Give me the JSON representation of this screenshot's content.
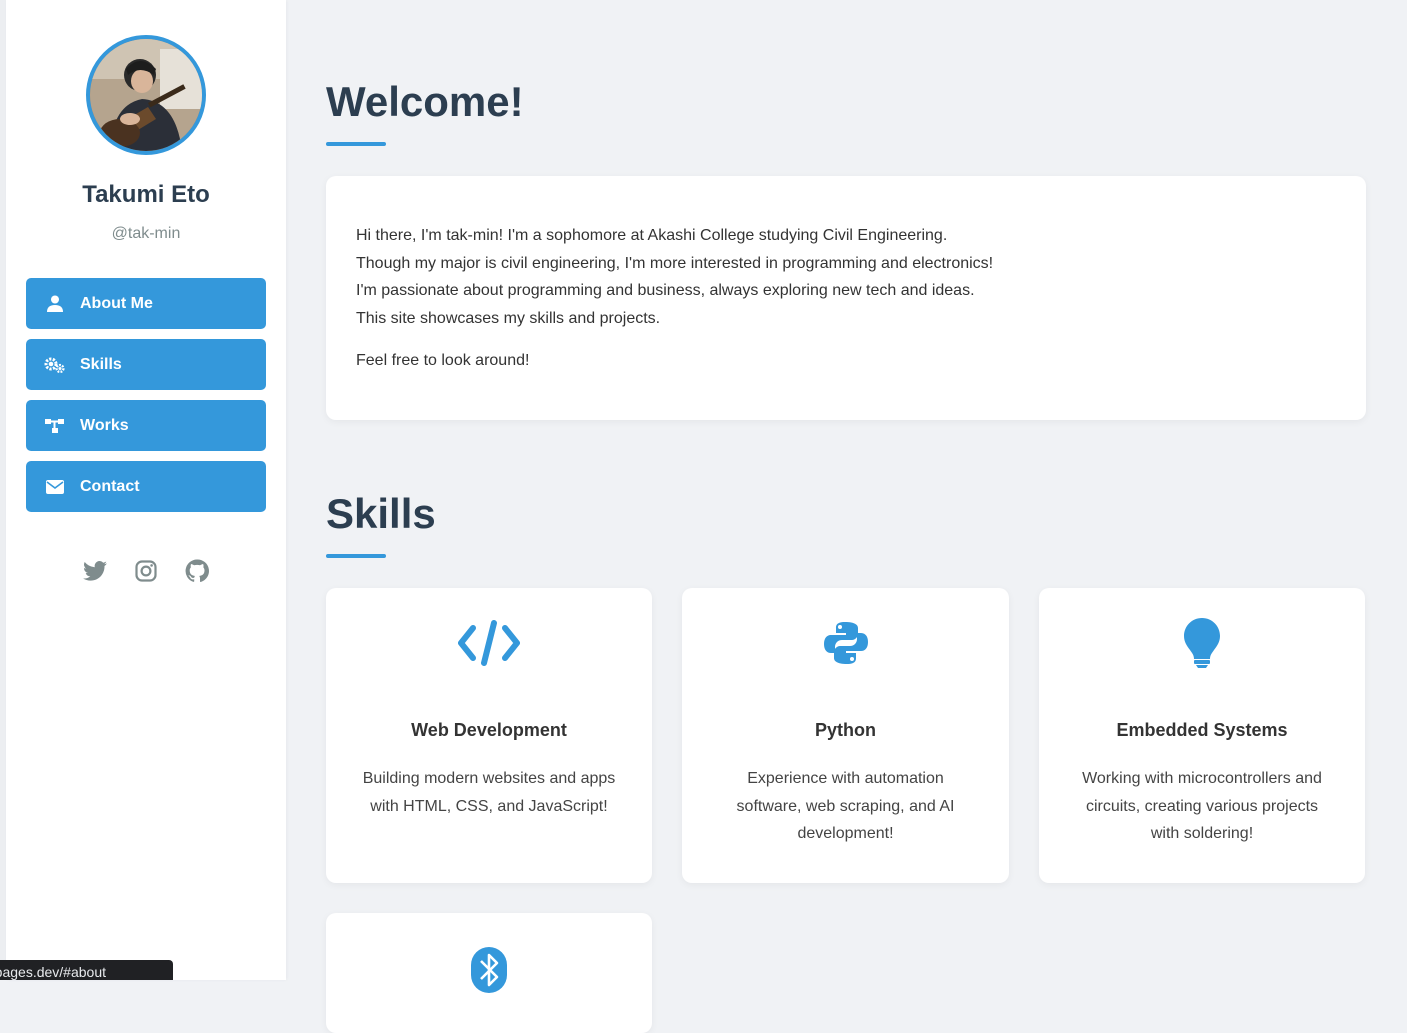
{
  "profile": {
    "name": "Takumi Eto",
    "handle": "@tak-min"
  },
  "nav": {
    "items": [
      {
        "label": "About Me",
        "icon": "user-icon"
      },
      {
        "label": "Skills",
        "icon": "gears-icon"
      },
      {
        "label": "Works",
        "icon": "sitemap-icon"
      },
      {
        "label": "Contact",
        "icon": "envelope-icon"
      }
    ]
  },
  "social": [
    "twitter-icon",
    "instagram-icon",
    "github-icon"
  ],
  "welcome": {
    "title": "Welcome!",
    "lines": [
      "Hi there, I'm tak-min! I'm a sophomore at Akashi College studying Civil Engineering.",
      "Though my major is civil engineering, I'm more interested in programming and electronics!",
      "I'm passionate about programming and business, always exploring new tech and ideas.",
      "This site showcases my skills and projects."
    ],
    "closing": "Feel free to look around!"
  },
  "skills": {
    "title": "Skills",
    "items": [
      {
        "title": "Web Development",
        "description": "Building modern websites and apps with HTML, CSS, and JavaScript!",
        "icon": "code-icon"
      },
      {
        "title": "Python",
        "description": "Experience with automation software, web scraping, and AI development!",
        "icon": "python-icon"
      },
      {
        "title": "Embedded Systems",
        "description": "Working with microcontrollers and circuits, creating various projects with soldering!",
        "icon": "lightbulb-icon"
      },
      {
        "title": "",
        "description": "",
        "icon": "bluetooth-icon"
      }
    ]
  },
  "status_bar": {
    "url": "os.pages.dev/#about"
  },
  "colors": {
    "accent": "#3498db",
    "heading": "#2c3e50",
    "background": "#f0f2f5"
  }
}
